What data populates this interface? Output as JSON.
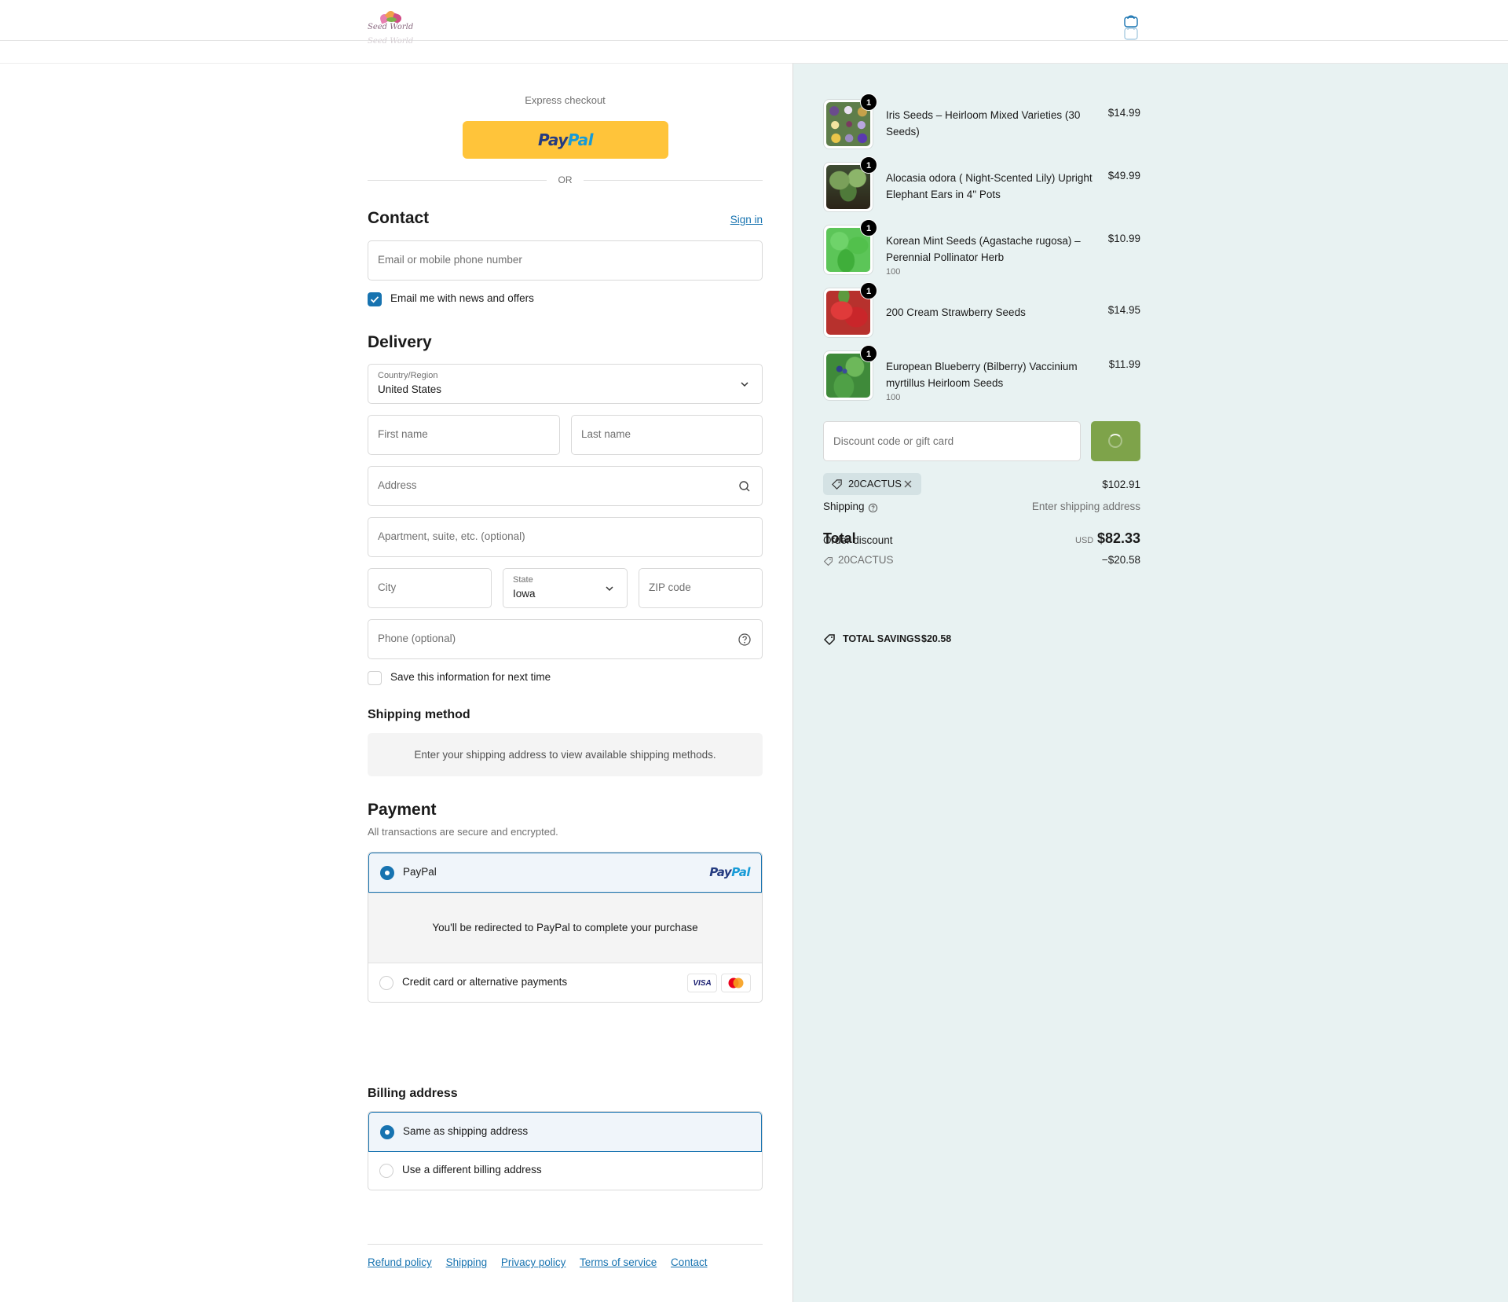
{
  "header": {
    "logo_text": "Seed World",
    "logo_text_faded": "Seed World"
  },
  "express": {
    "title": "Express checkout",
    "paypal_a": "Pay",
    "paypal_b": "Pal",
    "or": "OR"
  },
  "contact": {
    "title": "Contact",
    "sign_in": "Sign in",
    "email_placeholder": "Email or mobile phone number",
    "newsletter_label": "Email me with news and offers",
    "newsletter_checked": true
  },
  "delivery": {
    "title": "Delivery",
    "country_label": "Country/Region",
    "country_value": "United States",
    "first_name": "First name",
    "last_name": "Last name",
    "address": "Address",
    "apartment": "Apartment, suite, etc. (optional)",
    "city": "City",
    "state_label": "State",
    "state_value": "Iowa",
    "zip": "ZIP code",
    "phone": "Phone (optional)",
    "save_label": "Save this information for next time",
    "save_checked": false
  },
  "shipping_method": {
    "title": "Shipping method",
    "message": "Enter your shipping address to view available shipping methods."
  },
  "payment": {
    "title": "Payment",
    "subtitle": "All transactions are secure and encrypted.",
    "paypal_option": "PayPal",
    "paypal_logo_a": "Pay",
    "paypal_logo_b": "Pal",
    "redirect_message": "You'll be redirected to PayPal to complete your purchase",
    "card_option": "Credit card or alternative payments",
    "visa": "VISA"
  },
  "billing": {
    "title": "Billing address",
    "same": "Same as shipping address",
    "different": "Use a different billing address"
  },
  "footer": {
    "links": [
      "Refund policy",
      "Shipping",
      "Privacy policy",
      "Terms of service",
      "Contact"
    ]
  },
  "summary": {
    "items": [
      {
        "title": "Iris Seeds – Heirloom Mixed Varieties (30 Seeds)",
        "price": "$14.99",
        "qty": "1",
        "variant": ""
      },
      {
        "title": "Alocasia odora ( Night-Scented Lily) Upright Elephant Ears in 4\" Pots",
        "price": "$49.99",
        "qty": "1",
        "variant": ""
      },
      {
        "title": "Korean Mint Seeds (Agastache rugosa) – Perennial Pollinator Herb",
        "price": "$10.99",
        "qty": "1",
        "variant": "100"
      },
      {
        "title": "200 Cream Strawberry Seeds",
        "price": "$14.95",
        "qty": "1",
        "variant": ""
      },
      {
        "title": "European Blueberry (Bilberry) Vaccinium myrtillus Heirloom Seeds",
        "price": "$11.99",
        "qty": "1",
        "variant": "100"
      }
    ],
    "discount_placeholder": "Discount code or gift card",
    "code": "20CACTUS",
    "subtotal_value": "$102.91",
    "shipping_label": "Shipping",
    "shipping_value": "Enter shipping address",
    "total_label": "Total",
    "order_discount_label": "Order discount",
    "currency": "USD",
    "total_value": "$82.33",
    "discount_code": "20CACTUS",
    "discount_value": "−$20.58",
    "savings_label": "TOTAL SAVINGS",
    "savings_value": "$20.58"
  },
  "colors": {
    "accent": "#1773b0",
    "summary_bg": "#e8f2f2",
    "paypal_yellow": "#ffc43a",
    "apply_green": "#7ea34a"
  }
}
